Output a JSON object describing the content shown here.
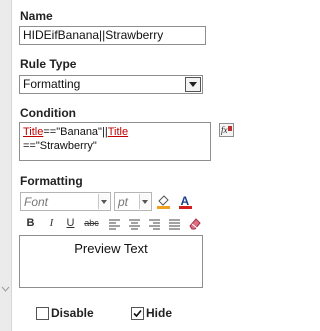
{
  "name": {
    "label": "Name",
    "value": "HIDEifBanana||Strawberry"
  },
  "rule_type": {
    "label": "Rule Type",
    "selected": "Formatting"
  },
  "condition": {
    "label": "Condition",
    "parts": [
      "Title",
      "==\"Banana\"||",
      "Title",
      "==\"Strawberry\""
    ]
  },
  "formatting": {
    "label": "Formatting",
    "font_placeholder": "Font",
    "size_placeholder": "pt",
    "bold": "B",
    "italic": "I",
    "underline": "U",
    "strike": "abc",
    "preview": "Preview Text"
  },
  "options": {
    "disable_label": "Disable",
    "disable_checked": false,
    "hide_label": "Hide",
    "hide_checked": true
  },
  "colors": {
    "keyword": "#c00000",
    "fill": "#f0a020",
    "font_color": "#d02020"
  },
  "icons": [
    "chevron-down-icon",
    "function-icon",
    "fill-color-icon",
    "font-color-icon",
    "align-left-icon",
    "align-center-icon",
    "align-right-icon",
    "justify-icon",
    "clear-format-icon"
  ]
}
